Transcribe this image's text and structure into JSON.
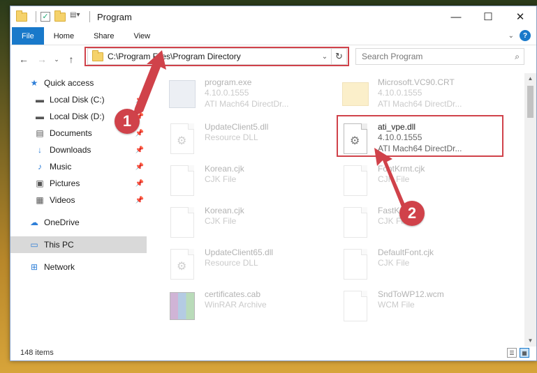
{
  "window": {
    "title": "Program",
    "controls": {
      "minimize": "—",
      "maximize": "☐",
      "close": "✕"
    }
  },
  "ribbon": {
    "tabs": [
      "File",
      "Home",
      "Share",
      "View"
    ]
  },
  "nav": {
    "back": "←",
    "forward": "→",
    "up": "↑",
    "address": "C:\\Program Files\\Program Directory",
    "search_placeholder": "Search Program"
  },
  "sidebar": {
    "items": [
      {
        "label": "Quick access",
        "icon": "star-icon",
        "glyph": "★",
        "pinned": false
      },
      {
        "label": "Local Disk (C:)",
        "icon": "drive-icon",
        "glyph": "▬",
        "pinned": true
      },
      {
        "label": "Local Disk (D:)",
        "icon": "drive-icon",
        "glyph": "▬",
        "pinned": true
      },
      {
        "label": "Documents",
        "icon": "documents-icon",
        "glyph": "▤",
        "pinned": true
      },
      {
        "label": "Downloads",
        "icon": "download-icon",
        "glyph": "↓",
        "pinned": true
      },
      {
        "label": "Music",
        "icon": "music-icon",
        "glyph": "♪",
        "pinned": true
      },
      {
        "label": "Pictures",
        "icon": "pictures-icon",
        "glyph": "▣",
        "pinned": true
      },
      {
        "label": "Videos",
        "icon": "videos-icon",
        "glyph": "▦",
        "pinned": true
      },
      {
        "label": "OneDrive",
        "icon": "cloud-icon",
        "glyph": "☁",
        "pinned": false
      },
      {
        "label": "This PC",
        "icon": "computer-icon",
        "glyph": "▭",
        "pinned": false
      },
      {
        "label": "Network",
        "icon": "network-icon",
        "glyph": "⊞",
        "pinned": false
      }
    ]
  },
  "files": [
    {
      "name": "program.exe",
      "line2": "4.10.0.1555",
      "line3": "ATI Mach64 DirectDr...",
      "kind": "exe",
      "faded": true
    },
    {
      "name": "Microsoft.VC90.CRT",
      "line2": "4.10.0.1555",
      "line3": "ATI Mach64 DirectDr...",
      "kind": "folder",
      "faded": true
    },
    {
      "name": "UpdateClient5.dll",
      "line2": "Resource DLL",
      "line3": "",
      "kind": "dll",
      "faded": true
    },
    {
      "name": "ati_vpe.dll",
      "line2": "4.10.0.1555",
      "line3": "ATI Mach64 DirectDr...",
      "kind": "dll",
      "faded": false
    },
    {
      "name": "Korean.cjk",
      "line2": "CJK File",
      "line3": "",
      "kind": "doc",
      "faded": true
    },
    {
      "name": "FontKrmt.cjk",
      "line2": "CJK File",
      "line3": "",
      "kind": "doc",
      "faded": true
    },
    {
      "name": "Korean.cjk",
      "line2": "CJK File",
      "line3": "",
      "kind": "doc",
      "faded": true
    },
    {
      "name": "FastKor",
      "line2": "CJK File",
      "line3": "",
      "kind": "doc",
      "faded": true
    },
    {
      "name": "UpdateClient65.dll",
      "line2": "Resource DLL",
      "line3": "",
      "kind": "dll",
      "faded": true
    },
    {
      "name": "DefaultFont.cjk",
      "line2": "CJK File",
      "line3": "",
      "kind": "doc",
      "faded": true
    },
    {
      "name": "certificates.cab",
      "line2": "WinRAR Archive",
      "line3": "",
      "kind": "cab",
      "faded": true
    },
    {
      "name": "SndToWP12.wcm",
      "line2": "WCM File",
      "line3": "",
      "kind": "doc",
      "faded": true
    }
  ],
  "status": {
    "count": "148 items"
  },
  "callouts": [
    "1",
    "2"
  ],
  "colors": {
    "accent": "#1979ca",
    "highlight": "#d0424a"
  }
}
